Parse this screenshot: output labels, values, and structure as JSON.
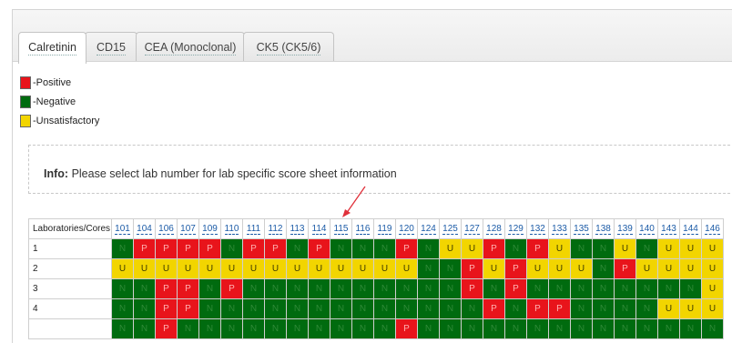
{
  "tabs": [
    {
      "label": "Calretinin",
      "active": true
    },
    {
      "label": "CD15",
      "active": false
    },
    {
      "label": "CEA (Monoclonal)",
      "active": false
    },
    {
      "label": "CK5 (CK5/6)",
      "active": false
    }
  ],
  "legend": [
    {
      "label": "-Positive",
      "color": "#e8141b"
    },
    {
      "label": "-Negative",
      "color": "#006b0f"
    },
    {
      "label": "-Unsatisfactory",
      "color": "#f2d500"
    }
  ],
  "info": {
    "heading": "Info:",
    "text": "Please select lab number for lab specific score sheet information"
  },
  "table": {
    "corner_label": "Laboratories/Cores",
    "lab_numbers": [
      "101",
      "104",
      "106",
      "107",
      "109",
      "110",
      "111",
      "112",
      "113",
      "114",
      "115",
      "116",
      "119",
      "120",
      "124",
      "125",
      "127",
      "128",
      "129",
      "132",
      "133",
      "135",
      "138",
      "139",
      "140",
      "143",
      "144",
      "146"
    ],
    "rows": [
      {
        "label": "1",
        "cells": [
          "N",
          "P",
          "P",
          "P",
          "P",
          "N",
          "P",
          "P",
          "N",
          "P",
          "N",
          "N",
          "N",
          "P",
          "N",
          "U",
          "U",
          "P",
          "N",
          "P",
          "U",
          "N",
          "N",
          "U",
          "N",
          "U",
          "U",
          "U"
        ]
      },
      {
        "label": "2",
        "cells": [
          "U",
          "U",
          "U",
          "U",
          "U",
          "U",
          "U",
          "U",
          "U",
          "U",
          "U",
          "U",
          "U",
          "U",
          "N",
          "N",
          "P",
          "U",
          "P",
          "U",
          "U",
          "U",
          "N",
          "P",
          "U",
          "U",
          "U",
          "U"
        ]
      },
      {
        "label": "3",
        "cells": [
          "N",
          "N",
          "P",
          "P",
          "N",
          "P",
          "N",
          "N",
          "N",
          "N",
          "N",
          "N",
          "N",
          "N",
          "N",
          "N",
          "P",
          "N",
          "P",
          "N",
          "N",
          "N",
          "N",
          "N",
          "N",
          "N",
          "N",
          "U"
        ]
      },
      {
        "label": "4",
        "cells": [
          "N",
          "N",
          "P",
          "P",
          "N",
          "N",
          "N",
          "N",
          "N",
          "N",
          "N",
          "N",
          "N",
          "N",
          "N",
          "N",
          "N",
          "P",
          "N",
          "P",
          "P",
          "N",
          "N",
          "N",
          "N",
          "U",
          "U",
          "U"
        ]
      },
      {
        "label": "",
        "cells": [
          "N",
          "N",
          "P",
          "N",
          "N",
          "N",
          "N",
          "N",
          "N",
          "N",
          "N",
          "N",
          "N",
          "P",
          "N",
          "N",
          "N",
          "N",
          "N",
          "N",
          "N",
          "N",
          "N",
          "N",
          "N",
          "N",
          "N",
          "N"
        ]
      }
    ]
  }
}
